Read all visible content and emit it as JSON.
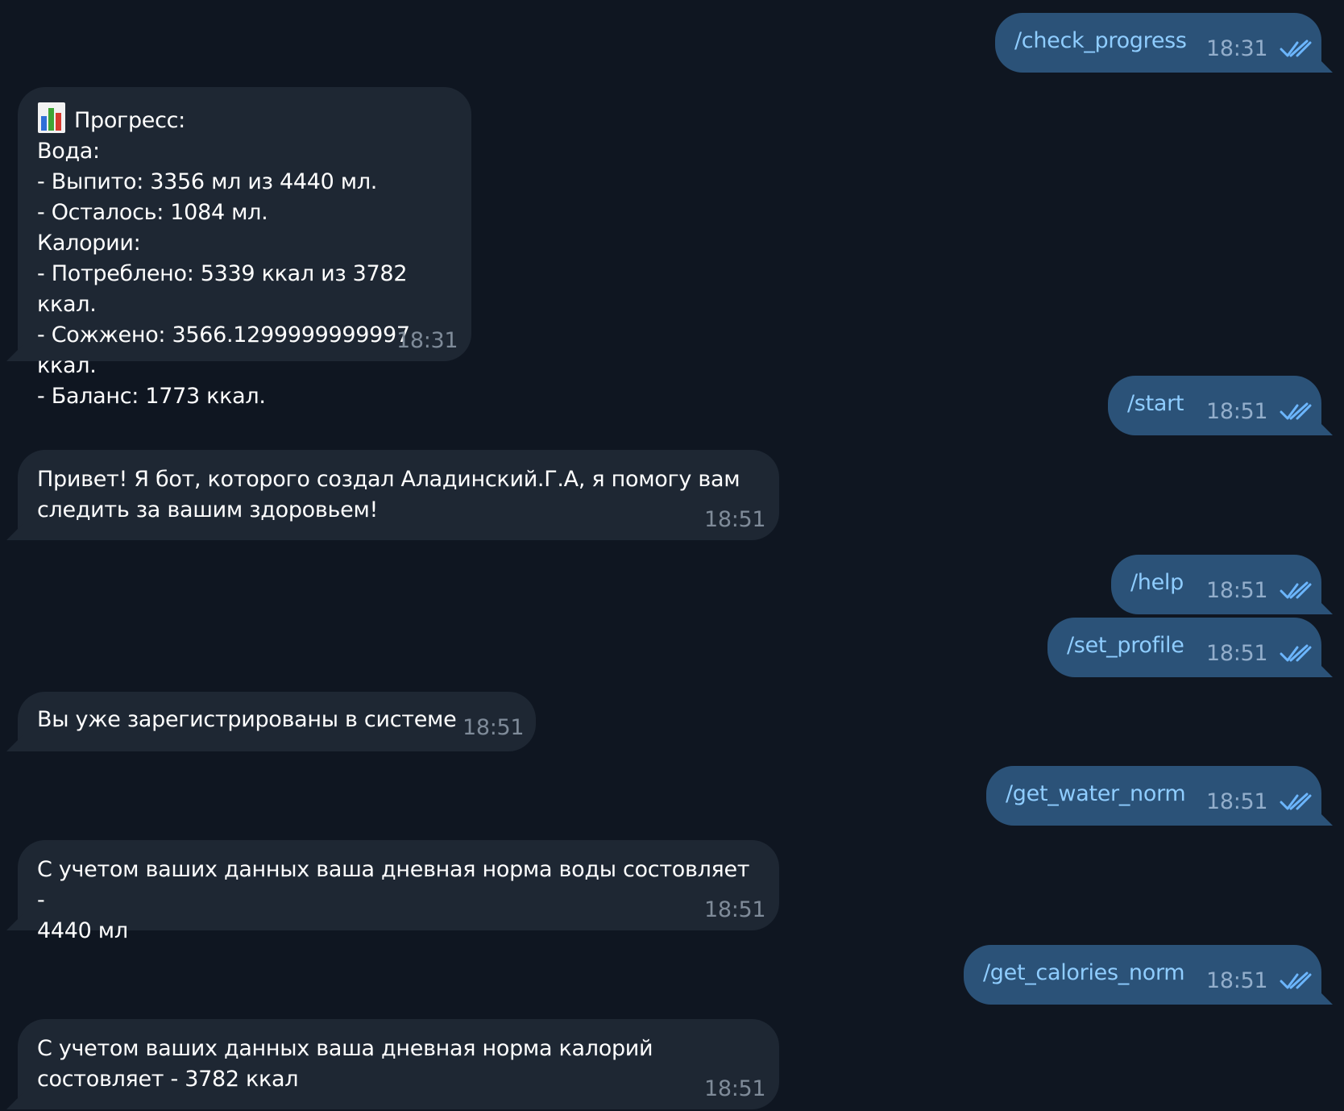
{
  "messages": [
    {
      "dir": "out",
      "text": "/check_progress",
      "time": "18:31",
      "status_icon": "double-check-icon"
    },
    {
      "dir": "in",
      "emoji_icon": "bar-chart-icon",
      "text": "Прогресс:\nВода:\n- Выпито: 3356 мл из 4440 мл.\n- Осталось: 1084 мл.\nКалории:\n- Потреблено: 5339 ккал из 3782 ккал.\n- Сожжено: 3566.1299999999997 ккал.\n- Баланс: 1773 ккал.",
      "time": "18:31"
    },
    {
      "dir": "out",
      "text": "/start",
      "time": "18:51",
      "status_icon": "double-check-icon"
    },
    {
      "dir": "in",
      "text": "Привет! Я бот, которого создал Аладинский.Г.А, я помогу вам\nследить за вашим здоровьем!",
      "time": "18:51"
    },
    {
      "dir": "out",
      "text": "/help",
      "time": "18:51",
      "status_icon": "double-check-icon"
    },
    {
      "dir": "out",
      "text": "/set_profile",
      "time": "18:51",
      "status_icon": "double-check-icon"
    },
    {
      "dir": "in",
      "text": "Вы уже зарегистрированы в системе",
      "time": "18:51"
    },
    {
      "dir": "out",
      "text": "/get_water_norm",
      "time": "18:51",
      "status_icon": "double-check-icon"
    },
    {
      "dir": "in",
      "text": "С учетом ваших данных ваша дневная норма воды состовляет -\n4440 мл",
      "time": "18:51"
    },
    {
      "dir": "out",
      "text": "/get_calories_norm",
      "time": "18:51",
      "status_icon": "double-check-icon"
    },
    {
      "dir": "in",
      "text": "С учетом ваших данных ваша дневная норма калорий\nсостовляет - 3782 ккал",
      "time": "18:51"
    }
  ],
  "colors": {
    "background": "#0f1621",
    "incoming_bubble": "#1e2733",
    "outgoing_bubble": "#2b5278",
    "outgoing_text": "#8fcdff",
    "check_marks": "#6cb6ff"
  }
}
